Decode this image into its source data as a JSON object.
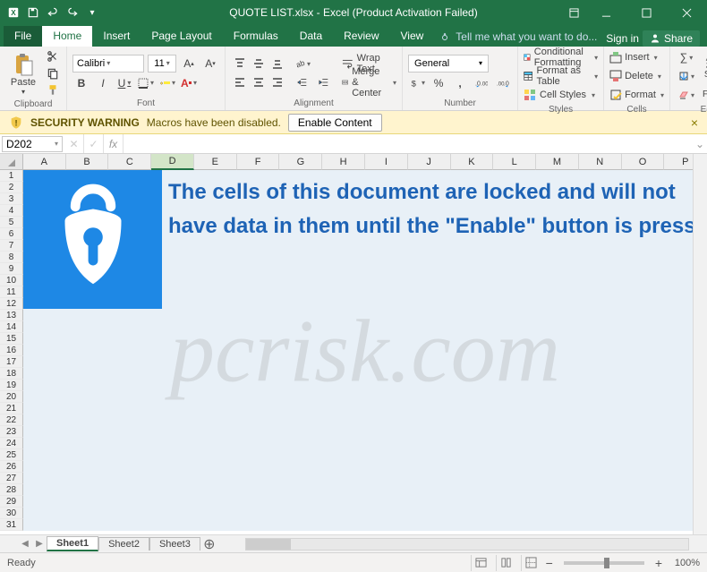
{
  "titlebar": {
    "title": "QUOTE LIST.xlsx - Excel (Product Activation Failed)"
  },
  "tabs": {
    "file": "File",
    "home": "Home",
    "insert": "Insert",
    "pagelayout": "Page Layout",
    "formulas": "Formulas",
    "data": "Data",
    "review": "Review",
    "view": "View",
    "tellme": "Tell me what you want to do...",
    "signin": "Sign in",
    "share": "Share"
  },
  "ribbon": {
    "clipboard": {
      "paste": "Paste",
      "label": "Clipboard"
    },
    "font": {
      "name": "Calibri",
      "size": "11",
      "label": "Font",
      "bold": "B",
      "italic": "I",
      "underline": "U"
    },
    "alignment": {
      "label": "Alignment",
      "wrap": "Wrap Text",
      "merge": "Merge & Center"
    },
    "number": {
      "format": "General",
      "label": "Number"
    },
    "styles": {
      "cond": "Conditional Formatting",
      "table": "Format as Table",
      "cell": "Cell Styles",
      "label": "Styles"
    },
    "cells": {
      "insert": "Insert",
      "delete": "Delete",
      "format": "Format",
      "label": "Cells"
    },
    "editing": {
      "sort": "Sort & Filter",
      "find": "Find & Select",
      "label": "Editing"
    }
  },
  "security": {
    "title": "SECURITY WARNING",
    "text": "Macros have been disabled.",
    "button": "Enable Content"
  },
  "namebox": {
    "ref": "D202",
    "fx": "fx"
  },
  "columns": [
    "A",
    "B",
    "C",
    "D",
    "E",
    "F",
    "G",
    "H",
    "I",
    "J",
    "K",
    "L",
    "M",
    "N",
    "O",
    "P"
  ],
  "rows_count": 31,
  "doc": {
    "line1": "The cells of this document are locked and will not",
    "line2": "have data in them until the \"Enable\" button is pressed."
  },
  "watermark": "pcrisk.com",
  "sheets": {
    "nav": "◀ ▶",
    "s1": "Sheet1",
    "s2": "Sheet2",
    "s3": "Sheet3",
    "add": "⊕"
  },
  "status": {
    "ready": "Ready",
    "zoom": "100%",
    "minus": "−",
    "plus": "+"
  }
}
